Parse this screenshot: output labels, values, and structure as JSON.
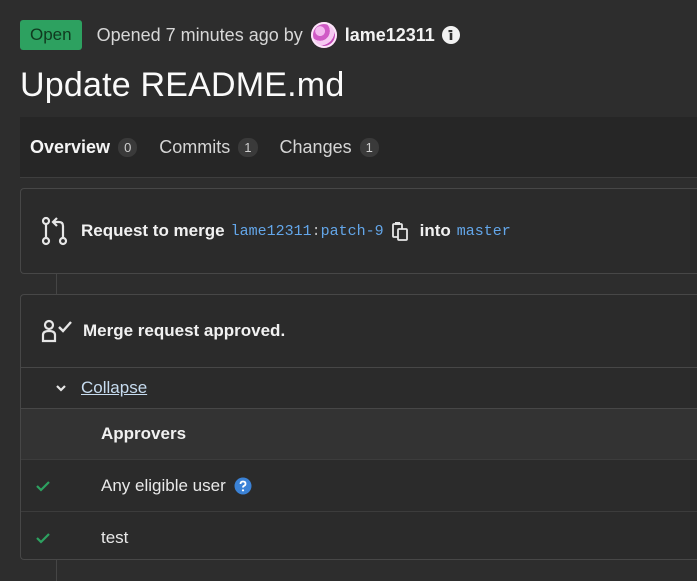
{
  "header": {
    "status": "Open",
    "opened_text": "Opened 7 minutes ago by",
    "author": "lame12311"
  },
  "title": "Update README.md",
  "tabs": [
    {
      "label": "Overview",
      "count": "0"
    },
    {
      "label": "Commits",
      "count": "1"
    },
    {
      "label": "Changes",
      "count": "1"
    }
  ],
  "merge_request": {
    "prefix": "Request to merge",
    "source_owner": "lame12311",
    "separator": ":",
    "source_branch": "patch-9",
    "into": "into",
    "target_branch": "master"
  },
  "approval": {
    "status_text": "Merge request approved.",
    "collapse_label": "Collapse",
    "approvers_header": "Approvers",
    "approvers": [
      {
        "name": "Any eligible user"
      },
      {
        "name": "test"
      }
    ]
  },
  "colors": {
    "status_badge": "#2da160",
    "link": "#63a6e9",
    "check": "#2da160",
    "help": "#3b82d6"
  },
  "icons": [
    "info-icon",
    "merge-request-icon",
    "copy-icon",
    "approval-icon",
    "chevron-down-icon",
    "check-icon",
    "help-icon"
  ]
}
